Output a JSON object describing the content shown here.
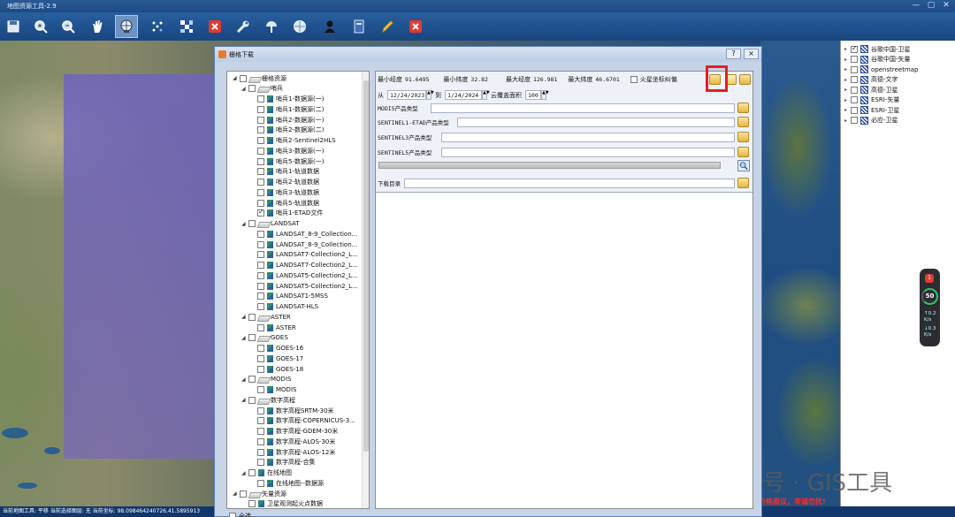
{
  "app": {
    "title": "地图资源工具-2.9",
    "status_text": "当前地图工具: 平移  当前选择图层: 无  当前坐标: 98.098464240726,41.5895913",
    "warning_text": "价格面议，非诚勿扰!",
    "watermark": "公众号 · GIS工具"
  },
  "toolbar": {
    "icons": [
      "save-icon",
      "zoom-in-icon",
      "zoom-out-icon",
      "pan-hand-icon",
      "globe-select-icon",
      "grid-icon",
      "checker-icon",
      "clear-icon",
      "settings-wrench-icon",
      "satellite-dish-icon",
      "world-icon",
      "user-icon",
      "book-icon",
      "pencil-icon",
      "close-icon"
    ]
  },
  "layers": {
    "items": [
      {
        "label": "谷歌中国-卫星",
        "checked": true
      },
      {
        "label": "谷歌中国-矢量",
        "checked": false
      },
      {
        "label": "openstreetmap",
        "checked": false
      },
      {
        "label": "高德-文字",
        "checked": false
      },
      {
        "label": "高德-卫星",
        "checked": false
      },
      {
        "label": "ESRI-矢量",
        "checked": false
      },
      {
        "label": "ESRI-卫星",
        "checked": false
      },
      {
        "label": "必应-卫星",
        "checked": false
      }
    ]
  },
  "zoom_widget": {
    "badge": "1",
    "level": "50",
    "v1": "0.2",
    "v1u": "K/s",
    "v2": "0.3",
    "v2u": "K/s"
  },
  "dialog": {
    "title": "栅格下载",
    "help_label": "?",
    "close_label": "×",
    "select_all_label": "全选",
    "tree": [
      {
        "label": "栅格资源",
        "level": 0,
        "type": "folder",
        "expanded": true,
        "checked": false
      },
      {
        "label": "哨兵",
        "level": 1,
        "type": "folder",
        "expanded": true,
        "checked": false
      },
      {
        "label": "哨兵1-数据源(一)",
        "level": 2,
        "type": "leaf",
        "checked": false
      },
      {
        "label": "哨兵1-数据源(二)",
        "level": 2,
        "type": "leaf",
        "checked": false
      },
      {
        "label": "哨兵2-数据源(一)",
        "level": 2,
        "type": "leaf",
        "checked": false
      },
      {
        "label": "哨兵2-数据源(二)",
        "level": 2,
        "type": "leaf",
        "checked": false
      },
      {
        "label": "哨兵2-Sentinel2HLS",
        "level": 2,
        "type": "leaf",
        "checked": false
      },
      {
        "label": "哨兵3-数据源(一)",
        "level": 2,
        "type": "leaf",
        "checked": false
      },
      {
        "label": "哨兵5-数据源(一)",
        "level": 2,
        "type": "leaf",
        "checked": false
      },
      {
        "label": "哨兵1-轨道数据",
        "level": 2,
        "type": "leaf",
        "checked": false
      },
      {
        "label": "哨兵2-轨道数据",
        "level": 2,
        "type": "leaf",
        "checked": false
      },
      {
        "label": "哨兵3-轨道数据",
        "level": 2,
        "type": "leaf",
        "checked": false
      },
      {
        "label": "哨兵5-轨道数据",
        "level": 2,
        "type": "leaf",
        "checked": false
      },
      {
        "label": "哨兵1-ETAD文件",
        "level": 2,
        "type": "leaf",
        "checked": true
      },
      {
        "label": "LANDSAT",
        "level": 1,
        "type": "folder",
        "expanded": true,
        "checked": false
      },
      {
        "label": "LANDSAT_8-9_Collection...",
        "level": 2,
        "type": "leaf",
        "checked": false
      },
      {
        "label": "LANDSAT_8-9_Collection...",
        "level": 2,
        "type": "leaf",
        "checked": false
      },
      {
        "label": "LANDSAT7-Collection2_L...",
        "level": 2,
        "type": "leaf",
        "checked": false
      },
      {
        "label": "LANDSAT7-Collection2_L...",
        "level": 2,
        "type": "leaf",
        "checked": false
      },
      {
        "label": "LANDSAT5-Collection2_L...",
        "level": 2,
        "type": "leaf",
        "checked": false
      },
      {
        "label": "LANDSAT5-Collection2_L...",
        "level": 2,
        "type": "leaf",
        "checked": false
      },
      {
        "label": "LANDSAT1-5MSS",
        "level": 2,
        "type": "leaf",
        "checked": false
      },
      {
        "label": "LANDSAT-HLS",
        "level": 2,
        "type": "leaf",
        "checked": false
      },
      {
        "label": "ASTER",
        "level": 1,
        "type": "folder",
        "expanded": true,
        "checked": false
      },
      {
        "label": "ASTER",
        "level": 2,
        "type": "leaf",
        "checked": false
      },
      {
        "label": "GOES",
        "level": 1,
        "type": "folder",
        "expanded": true,
        "checked": false
      },
      {
        "label": "GOES-16",
        "level": 2,
        "type": "leaf",
        "checked": false
      },
      {
        "label": "GOES-17",
        "level": 2,
        "type": "leaf",
        "checked": false
      },
      {
        "label": "GOES-18",
        "level": 2,
        "type": "leaf",
        "checked": false
      },
      {
        "label": "MODIS",
        "level": 1,
        "type": "folder",
        "expanded": true,
        "checked": false
      },
      {
        "label": "MODIS",
        "level": 2,
        "type": "leaf",
        "checked": false
      },
      {
        "label": "数字高程",
        "level": 1,
        "type": "folder",
        "expanded": true,
        "checked": false
      },
      {
        "label": "数字高程SRTM-30米",
        "level": 2,
        "type": "leaf",
        "checked": false
      },
      {
        "label": "数字高程-COPERNICUS-3...",
        "level": 2,
        "type": "leaf",
        "checked": false
      },
      {
        "label": "数字高程-GDEM-30米",
        "level": 2,
        "type": "leaf",
        "checked": false
      },
      {
        "label": "数字高程-ALOS-30米",
        "level": 2,
        "type": "leaf",
        "checked": false
      },
      {
        "label": "数字高程-ALOS-12米",
        "level": 2,
        "type": "leaf",
        "checked": false
      },
      {
        "label": "数字高程-合集",
        "level": 2,
        "type": "leaf",
        "checked": false
      },
      {
        "label": "在线地图",
        "level": 1,
        "type": "leaf-folder",
        "expanded": true,
        "checked": false
      },
      {
        "label": "在线地图--数据源",
        "level": 2,
        "type": "leaf",
        "checked": false
      },
      {
        "label": "矢量资源",
        "level": 0,
        "type": "folder",
        "expanded": true,
        "checked": false
      },
      {
        "label": "卫星观测起火点数据",
        "level": 1,
        "type": "leaf",
        "checked": false
      }
    ],
    "form": {
      "min_lon_label": "最小经度",
      "min_lon": "91.6495",
      "min_lat_label": "最小纬度",
      "min_lat": "32.82",
      "max_lon_label": "最大经度",
      "max_lon": "126.981",
      "max_lat_label": "最大纬度",
      "max_lat": "46.6701",
      "mars_label": "火星坐标纠偏",
      "from_label": "从",
      "from_date": "12/24/2023",
      "to_label": "到",
      "to_date": "1/24/2024",
      "cloud_label": "云覆盖面积",
      "cloud_value": "100",
      "modis_label": "MODIS产品类型",
      "s1_label": "SENTINEL1-ETAD产品类型",
      "s3_label": "SENTINEL3产品类型",
      "s5_label": "SENTINEL5产品类型",
      "download_dir_label": "下载目录"
    }
  }
}
